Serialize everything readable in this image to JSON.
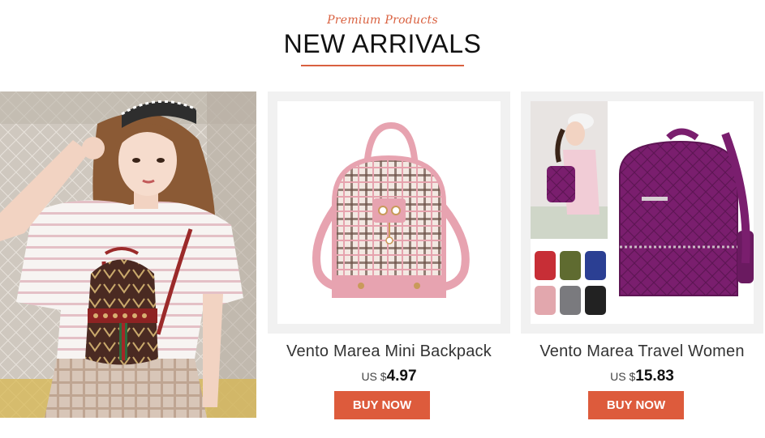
{
  "header": {
    "subtitle": "Premium Products",
    "title": "NEW ARRIVALS"
  },
  "products": [
    {
      "name": "Vento Marea Mini Backpack",
      "currency": "US $",
      "price": "4.97",
      "button": "BUY NOW",
      "image": "pink-plaid-mini-backpack"
    },
    {
      "name": "Vento Marea Travel Women",
      "currency": "US $",
      "price": "15.83",
      "button": "BUY NOW",
      "image": "purple-quilted-travel-backpack"
    }
  ],
  "colors": {
    "accent": "#d9603f",
    "button": "#dd5b3c",
    "card_frame": "#f1f1f1",
    "pink_bag": "#e7a3b0",
    "purple_bag": "#7a1e6e"
  },
  "color_variants": [
    "red",
    "olive",
    "blue",
    "pink",
    "gray",
    "black"
  ]
}
